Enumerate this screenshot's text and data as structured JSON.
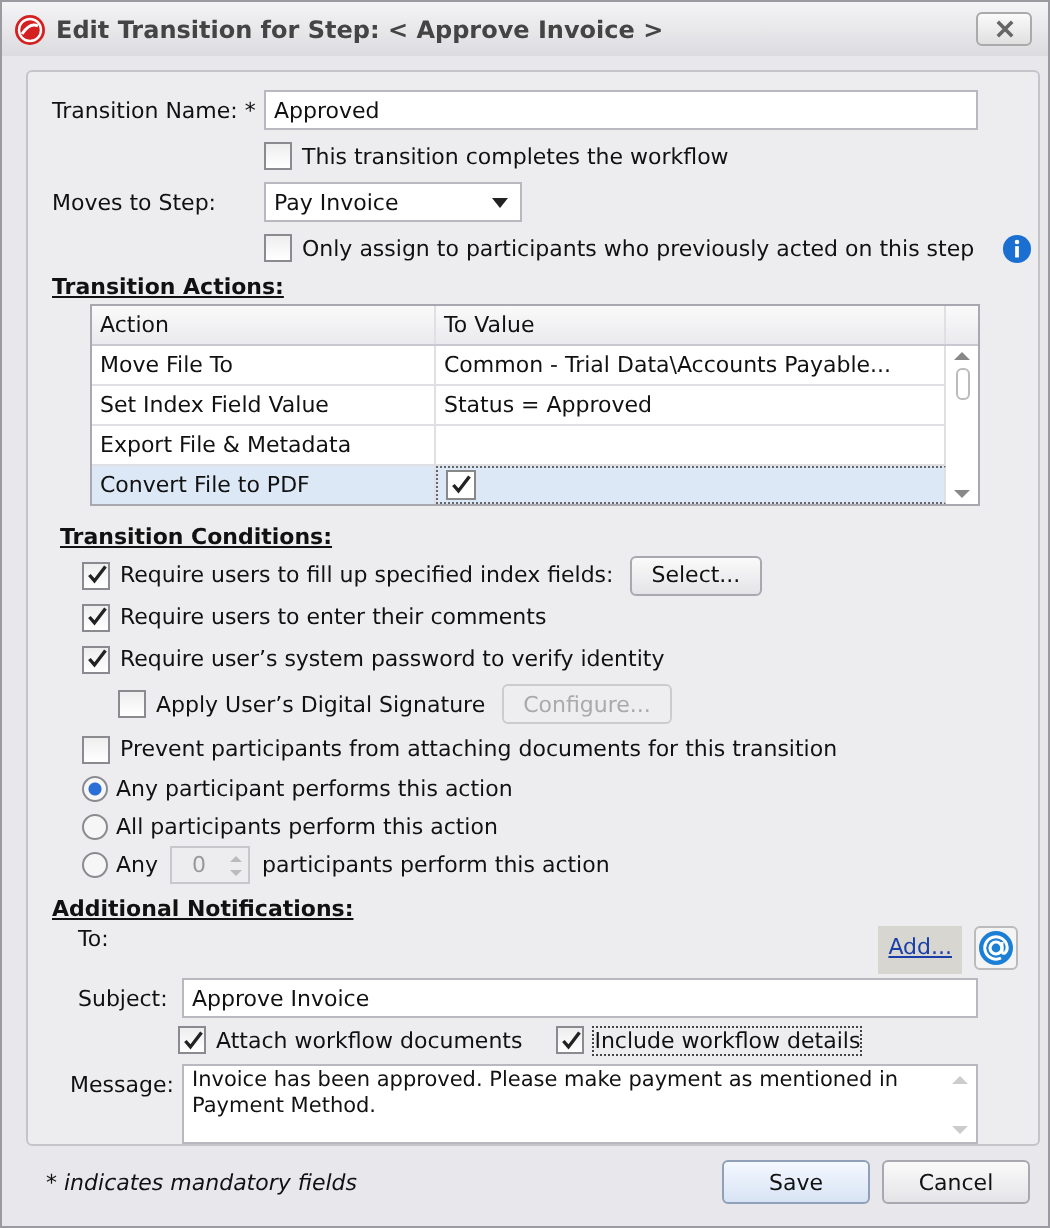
{
  "window": {
    "title": "Edit Transition for Step: < Approve Invoice >"
  },
  "transition_name": {
    "label": "Transition Name: *",
    "value": "Approved"
  },
  "completes_workflow": {
    "label": "This transition completes the workflow",
    "checked": false
  },
  "moves_to_step": {
    "label": "Moves to Step:",
    "value": "Pay Invoice"
  },
  "only_assign": {
    "label": "Only assign to participants who previously acted on this step",
    "checked": false
  },
  "transition_actions": {
    "heading": "Transition Actions:",
    "columns": [
      "Action",
      "To Value"
    ],
    "rows": [
      {
        "kind": "text",
        "action": "Move File To",
        "value": "Common - Trial Data\\Accounts Payable...",
        "selected": false
      },
      {
        "kind": "text",
        "action": "Set Index Field Value",
        "value": "Status = Approved",
        "selected": false
      },
      {
        "kind": "text",
        "action": "Export File & Metadata",
        "selected": false
      },
      {
        "kind": "checkbox",
        "action": "Convert File to PDF",
        "checked": true,
        "selected": true
      }
    ]
  },
  "transition_conditions": {
    "heading": "Transition Conditions:",
    "items": [
      {
        "kind": "checkbox",
        "label": "Require users to fill up specified index fields:",
        "checked": true,
        "button": {
          "label": "Select...",
          "disabled": false
        }
      },
      {
        "kind": "checkbox",
        "label": "Require users to enter their comments",
        "checked": true
      },
      {
        "kind": "checkbox",
        "label": "Require user’s system password to verify identity",
        "checked": true,
        "children": [
          {
            "kind": "checkbox",
            "label": "Apply User’s Digital Signature",
            "checked": false,
            "button": {
              "label": "Configure...",
              "disabled": true
            }
          }
        ]
      },
      {
        "kind": "checkbox",
        "label": "Prevent participants from attaching documents for this transition",
        "checked": false
      },
      {
        "kind": "radio",
        "label": "Any participant performs this action",
        "selected": true
      },
      {
        "kind": "radio",
        "label": "All participants perform this action",
        "selected": false
      },
      {
        "kind": "radio_count",
        "label": "Any",
        "count": "0",
        "label_after": "participants perform this action",
        "selected": false
      }
    ]
  },
  "additional_notifications": {
    "heading": "Additional Notifications:",
    "to_label": "To:",
    "add_link": "Add...",
    "subject": {
      "label": "Subject:",
      "value": "Approve Invoice"
    },
    "options": [
      {
        "label": "Attach workflow documents",
        "checked": true,
        "focused": false
      },
      {
        "label": "Include workflow details",
        "checked": true,
        "focused": true
      }
    ],
    "message": {
      "label": "Message:",
      "value": "Invoice has been approved. Please make payment as mentioned in Payment Method."
    }
  },
  "footer_note": "* indicates mandatory fields",
  "buttons": [
    {
      "label": "Save",
      "default": true
    },
    {
      "label": "Cancel",
      "default": false
    }
  ]
}
